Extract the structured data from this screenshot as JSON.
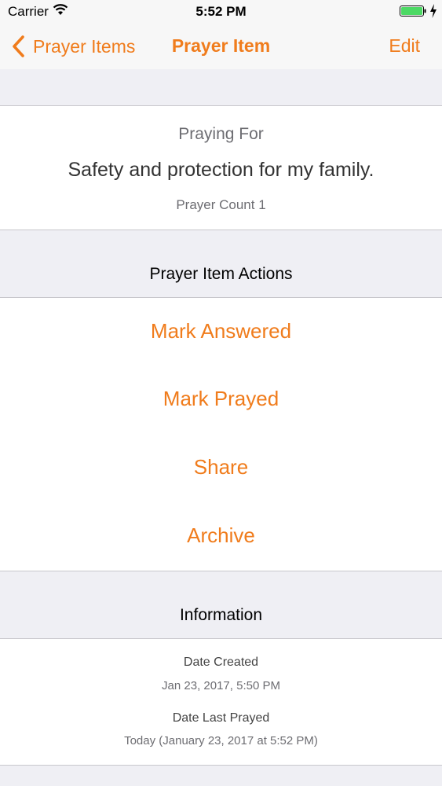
{
  "status_bar": {
    "carrier": "Carrier",
    "time": "5:52 PM",
    "battery_color": "#4cd964"
  },
  "nav": {
    "back_label": "Prayer Items",
    "title": "Prayer Item",
    "edit_label": "Edit",
    "accent_color": "#f07c1c"
  },
  "praying_for": {
    "label": "Praying For",
    "text": "Safety and protection for my family.",
    "count_text": "Prayer Count 1"
  },
  "actions": {
    "header": "Prayer Item Actions",
    "items": [
      {
        "label": "Mark Answered"
      },
      {
        "label": "Mark Prayed"
      },
      {
        "label": "Share"
      },
      {
        "label": "Archive"
      }
    ]
  },
  "information": {
    "header": "Information",
    "date_created_label": "Date Created",
    "date_created_value": "Jan 23, 2017, 5:50 PM",
    "date_last_prayed_label": "Date Last Prayed",
    "date_last_prayed_value": "Today (January 23, 2017 at 5:52 PM)"
  }
}
